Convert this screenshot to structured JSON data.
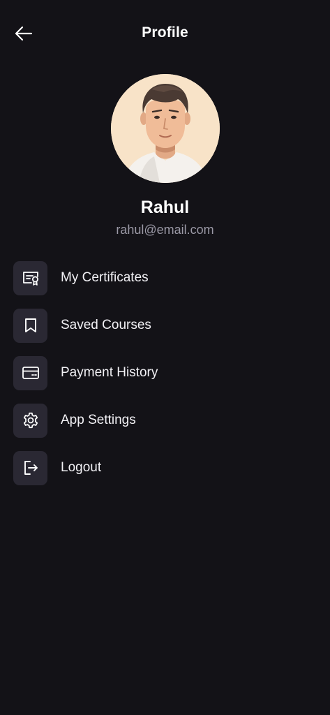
{
  "header": {
    "title": "Profile",
    "back_icon": "arrow-left-icon"
  },
  "profile": {
    "name": "Rahul",
    "email": "rahul@email.com",
    "avatar_icon": "user-avatar-illustration"
  },
  "menu": {
    "items": [
      {
        "label": "My Certificates",
        "icon": "certificate-icon"
      },
      {
        "label": "Saved Courses",
        "icon": "bookmark-icon"
      },
      {
        "label": "Payment History",
        "icon": "credit-card-icon"
      },
      {
        "label": "App Settings",
        "icon": "gear-icon"
      },
      {
        "label": "Logout",
        "icon": "logout-icon"
      }
    ]
  },
  "colors": {
    "background": "#131217",
    "icon_tile": "#2a2833",
    "muted_text": "#9b99a6",
    "avatar_bg": "#f8e3c8"
  }
}
